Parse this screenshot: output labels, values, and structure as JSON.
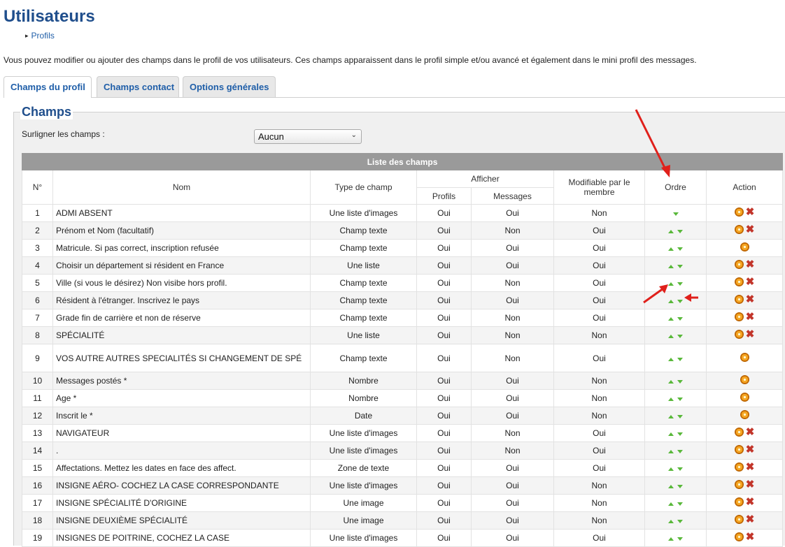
{
  "page": {
    "title": "Utilisateurs",
    "breadcrumb": "Profils",
    "intro": "Vous pouvez modifier ou ajouter des champs dans le profil de vos utilisateurs. Ces champs apparaissent dans le profil simple et/ou avancé et également dans le mini profil des messages."
  },
  "tabs": [
    {
      "label": "Champs du profil",
      "active": true
    },
    {
      "label": "Champs contact",
      "active": false
    },
    {
      "label": "Options générales",
      "active": false
    }
  ],
  "section": {
    "legend": "Champs",
    "filter_label": "Surligner les champs :",
    "filter_value": "Aucun"
  },
  "table": {
    "caption": "Liste des champs",
    "headers": {
      "num": "N°",
      "name": "Nom",
      "type": "Type de champ",
      "display": "Afficher",
      "profiles": "Profils",
      "messages": "Messages",
      "editable": "Modifiable par le membre",
      "order": "Ordre",
      "action": "Action"
    },
    "rows": [
      {
        "n": "1",
        "name": "ADMI ABSENT",
        "type": "Une liste d'images",
        "profils": "Oui",
        "messages": "Oui",
        "modifiable": "Non",
        "up": false,
        "down": true,
        "delete": true
      },
      {
        "n": "2",
        "name": "Prénom et Nom (facultatif)",
        "type": "Champ texte",
        "profils": "Oui",
        "messages": "Non",
        "modifiable": "Oui",
        "up": true,
        "down": true,
        "delete": true
      },
      {
        "n": "3",
        "name": "Matricule. Si pas correct, inscription refusée",
        "type": "Champ texte",
        "profils": "Oui",
        "messages": "Oui",
        "modifiable": "Oui",
        "up": true,
        "down": true,
        "delete": false
      },
      {
        "n": "4",
        "name": "Choisir un département si résident en France",
        "type": "Une liste",
        "profils": "Oui",
        "messages": "Oui",
        "modifiable": "Oui",
        "up": true,
        "down": true,
        "delete": true
      },
      {
        "n": "5",
        "name": "Ville (si vous le désirez) Non visibe hors profil.",
        "type": "Champ texte",
        "profils": "Oui",
        "messages": "Non",
        "modifiable": "Oui",
        "up": true,
        "down": true,
        "delete": true
      },
      {
        "n": "6",
        "name": "Résident à l'étranger. Inscrivez le pays",
        "type": "Champ texte",
        "profils": "Oui",
        "messages": "Oui",
        "modifiable": "Oui",
        "up": true,
        "down": true,
        "delete": true
      },
      {
        "n": "7",
        "name": "Grade fin de carrière et non de réserve",
        "type": "Champ texte",
        "profils": "Oui",
        "messages": "Non",
        "modifiable": "Oui",
        "up": true,
        "down": true,
        "delete": true
      },
      {
        "n": "8",
        "name": "SPÉCIALITÉ",
        "type": "Une liste",
        "profils": "Oui",
        "messages": "Non",
        "modifiable": "Non",
        "up": true,
        "down": true,
        "delete": true
      },
      {
        "n": "9",
        "name": "VOS AUTRE AUTRES SPECIALITÉS SI CHANGEMENT DE SPÉ",
        "type": "Champ texte",
        "profils": "Oui",
        "messages": "Non",
        "modifiable": "Oui",
        "up": true,
        "down": true,
        "delete": false
      },
      {
        "n": "10",
        "name": "Messages postés *",
        "type": "Nombre",
        "profils": "Oui",
        "messages": "Oui",
        "modifiable": "Non",
        "up": true,
        "down": true,
        "delete": false
      },
      {
        "n": "11",
        "name": "Age *",
        "type": "Nombre",
        "profils": "Oui",
        "messages": "Oui",
        "modifiable": "Non",
        "up": true,
        "down": true,
        "delete": false
      },
      {
        "n": "12",
        "name": "Inscrit le *",
        "type": "Date",
        "profils": "Oui",
        "messages": "Oui",
        "modifiable": "Non",
        "up": true,
        "down": true,
        "delete": false
      },
      {
        "n": "13",
        "name": "NAVIGATEUR",
        "type": "Une liste d'images",
        "profils": "Oui",
        "messages": "Non",
        "modifiable": "Oui",
        "up": true,
        "down": true,
        "delete": true
      },
      {
        "n": "14",
        "name": ".",
        "type": "Une liste d'images",
        "profils": "Oui",
        "messages": "Non",
        "modifiable": "Oui",
        "up": true,
        "down": true,
        "delete": true
      },
      {
        "n": "15",
        "name": "Affectations. Mettez les dates en face des affect.",
        "type": "Zone de texte",
        "profils": "Oui",
        "messages": "Oui",
        "modifiable": "Oui",
        "up": true,
        "down": true,
        "delete": true
      },
      {
        "n": "16",
        "name": "INSIGNE AÉRO- COCHEZ LA CASE CORRESPONDANTE",
        "type": "Une liste d'images",
        "profils": "Oui",
        "messages": "Oui",
        "modifiable": "Non",
        "up": true,
        "down": true,
        "delete": true
      },
      {
        "n": "17",
        "name": "INSIGNE SPÉCIALITÉ D'ORIGINE",
        "type": "Une image",
        "profils": "Oui",
        "messages": "Oui",
        "modifiable": "Non",
        "up": true,
        "down": true,
        "delete": true
      },
      {
        "n": "18",
        "name": "INSIGNE DEUXIÈME SPÉCIALITÉ",
        "type": "Une image",
        "profils": "Oui",
        "messages": "Oui",
        "modifiable": "Non",
        "up": true,
        "down": true,
        "delete": true
      },
      {
        "n": "19",
        "name": "INSIGNES DE POITRINE, COCHEZ LA CASE",
        "type": "Une liste d'images",
        "profils": "Oui",
        "messages": "Oui",
        "modifiable": "Oui",
        "up": true,
        "down": true,
        "delete": true
      }
    ]
  },
  "colors": {
    "title": "#1f4e8c",
    "link": "#1f5ea8",
    "header_bar": "#9a9a9a",
    "arrow_green": "#59b83a",
    "delete_red": "#c2352a",
    "annotation_red": "#e0201b"
  },
  "icons": {
    "order_up": "arrow-up-icon",
    "order_down": "arrow-down-icon",
    "edit": "edit-icon",
    "delete": "delete-icon"
  }
}
